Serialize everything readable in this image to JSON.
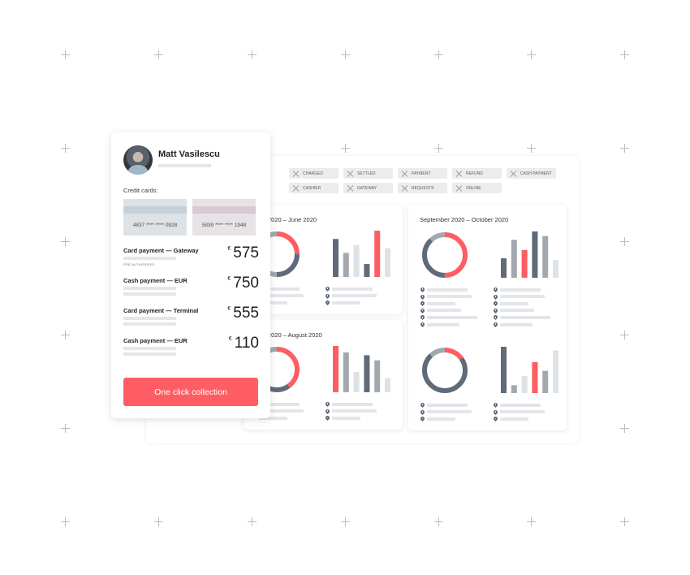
{
  "profile": {
    "name": "Matt Vasilescu",
    "credit_cards_label": "Credit cards:",
    "cards": [
      {
        "number": "4837 **** **** 0928",
        "color": "#dde2e6",
        "stripe": "#c5d0d9"
      },
      {
        "number": "5839 **** **** 1948",
        "color": "#e8e1e5",
        "stripe": "#d9c9d0"
      }
    ],
    "payments": [
      {
        "title": "Card payment — Gateway",
        "currency": "€",
        "amount": "575",
        "tag": "PRE-AUTHORISED"
      },
      {
        "title": "Cash payment — EUR",
        "currency": "€",
        "amount": "750"
      },
      {
        "title": "Card payment — Terminal",
        "currency": "€",
        "amount": "555"
      },
      {
        "title": "Cash payment — EUR",
        "currency": "€",
        "amount": "110"
      }
    ],
    "cta_label": "One click collection"
  },
  "filters": [
    "CHARGED",
    "SETTLED",
    "PAYMENT",
    "REFUND",
    "CASH PAYMENT",
    "CASHIER",
    "GATEWAY",
    "REQUESTS",
    "ONLINE"
  ],
  "colors": {
    "accent": "#fe5d63",
    "dark": "#5f6b78",
    "mid": "#a3a8ae",
    "light": "#dfe2e5"
  },
  "chart_data": [
    {
      "type": "bar",
      "title": "2020 – June 2020",
      "donut": [
        {
          "color": "accent",
          "value": 25
        },
        {
          "color": "dark",
          "value": 25
        },
        {
          "color": "mid",
          "value": 50
        }
      ],
      "bars": [
        {
          "value": 0.82,
          "color": "dark"
        },
        {
          "value": 0.52,
          "color": "mid"
        },
        {
          "value": 0.69,
          "color": "light"
        },
        {
          "value": 0.28,
          "color": "dark"
        },
        {
          "value": 1.0,
          "color": "accent"
        },
        {
          "value": 0.62,
          "color": "light"
        }
      ],
      "legend_rows": 3
    },
    {
      "type": "bar",
      "title": "September 2020 – October 2020",
      "donut": [
        {
          "color": "accent",
          "value": 50
        },
        {
          "color": "dark",
          "value": 38
        },
        {
          "color": "mid",
          "value": 12
        }
      ],
      "bars": [
        {
          "value": 0.42,
          "color": "dark"
        },
        {
          "value": 0.82,
          "color": "mid"
        },
        {
          "value": 0.6,
          "color": "accent"
        },
        {
          "value": 1.0,
          "color": "dark"
        },
        {
          "value": 0.9,
          "color": "mid"
        },
        {
          "value": 0.38,
          "color": "light"
        }
      ],
      "legend_rows": 6
    },
    {
      "type": "bar",
      "title": "2020 – August 2020",
      "donut": [
        {
          "color": "accent",
          "value": 40
        },
        {
          "color": "dark",
          "value": 30
        },
        {
          "color": "mid",
          "value": 30
        }
      ],
      "bars": [
        {
          "value": 1.0,
          "color": "accent"
        },
        {
          "value": 0.86,
          "color": "mid"
        },
        {
          "value": 0.44,
          "color": "light"
        },
        {
          "value": 0.8,
          "color": "dark"
        },
        {
          "value": 0.69,
          "color": "mid"
        },
        {
          "value": 0.31,
          "color": "light"
        }
      ],
      "legend_rows": 3
    },
    {
      "type": "bar",
      "title": "",
      "donut": [
        {
          "color": "accent",
          "value": 15
        },
        {
          "color": "dark",
          "value": 73
        },
        {
          "color": "mid",
          "value": 12
        }
      ],
      "bars": [
        {
          "value": 1.0,
          "color": "dark"
        },
        {
          "value": 0.17,
          "color": "mid"
        },
        {
          "value": 0.37,
          "color": "light"
        },
        {
          "value": 0.67,
          "color": "accent"
        },
        {
          "value": 0.48,
          "color": "mid"
        },
        {
          "value": 0.92,
          "color": "light"
        }
      ],
      "legend_rows": 3
    }
  ]
}
